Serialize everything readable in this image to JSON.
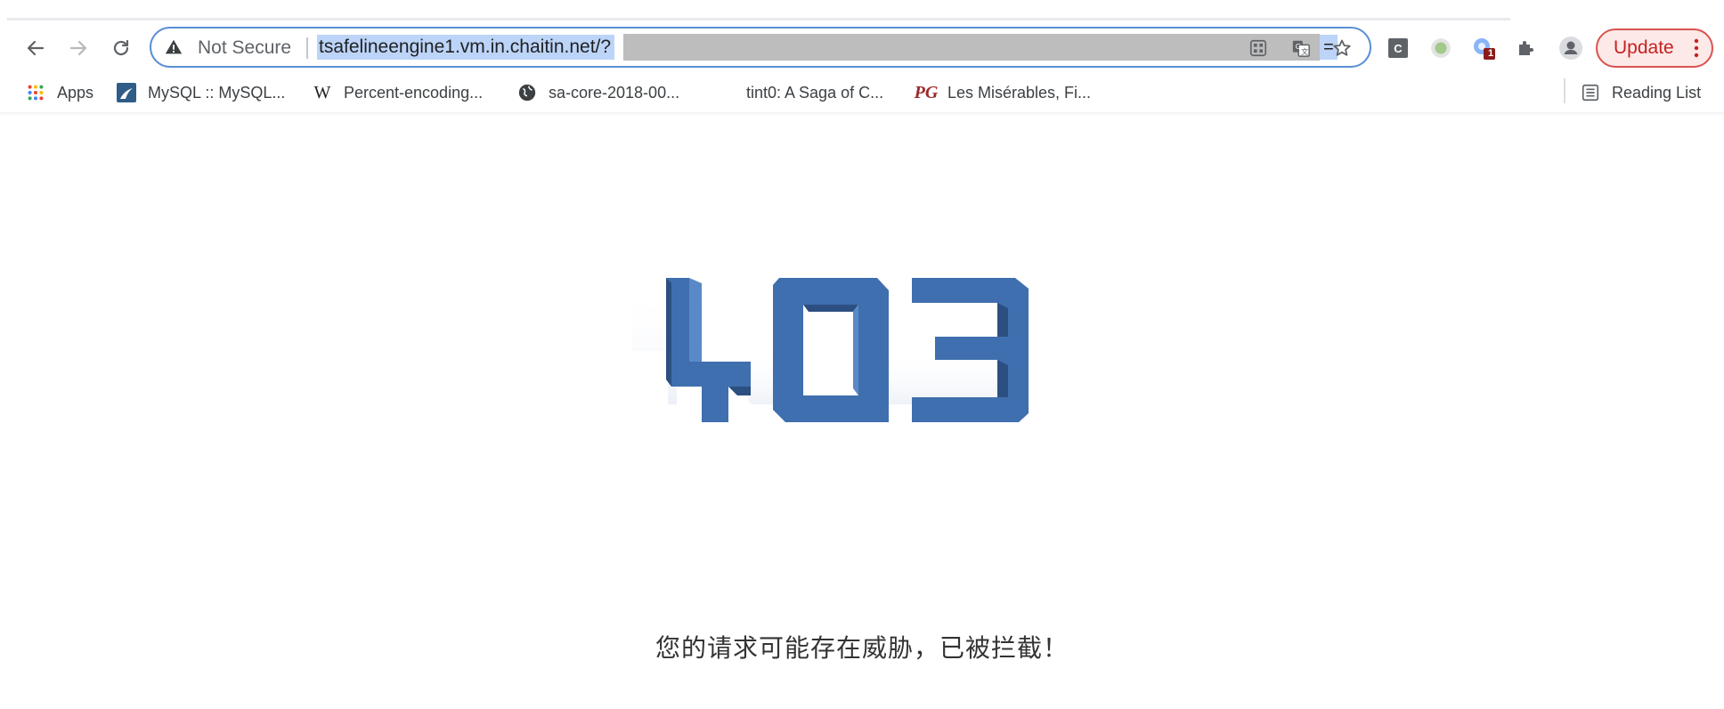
{
  "browser": {
    "security_label": "Not Secure",
    "url_visible": "tsafelineengine1.vm.in.chaitin.net/?",
    "url_tail": "=",
    "extension_badge_count": "1",
    "update_label": "Update"
  },
  "icons": {
    "back": "arrow-left-icon",
    "forward": "arrow-right-icon",
    "reload": "reload-icon",
    "warning": "warning-triangle-icon",
    "qr": "qr-code-icon",
    "translate": "translate-icon",
    "bookmark_star": "star-icon",
    "extensions": "puzzle-icon",
    "profile": "profile-icon",
    "menu": "kebab-menu-icon"
  },
  "bookmarks": {
    "items": [
      {
        "label": "Apps",
        "icon": "apps-grid-icon"
      },
      {
        "label": "MySQL :: MySQL...",
        "icon": "mysql-icon"
      },
      {
        "label": "Percent-encoding...",
        "icon": "wikipedia-icon"
      },
      {
        "label": "sa-core-2018-00...",
        "icon": "globe-icon"
      },
      {
        "label": "tint0: A Saga of C...",
        "icon": ""
      },
      {
        "label": "Les Misérables, Fi...",
        "icon": "gutenberg-icon"
      }
    ],
    "reading_list": "Reading List"
  },
  "page": {
    "error_code": "403",
    "message": "您的请求可能存在威胁，已被拦截！"
  },
  "colors": {
    "accent": "#3f6fae",
    "omnibox_border": "#5b8fd6",
    "url_highlight": "#bcd4f7",
    "update_border": "#d9534f",
    "update_text": "#c5221f"
  }
}
